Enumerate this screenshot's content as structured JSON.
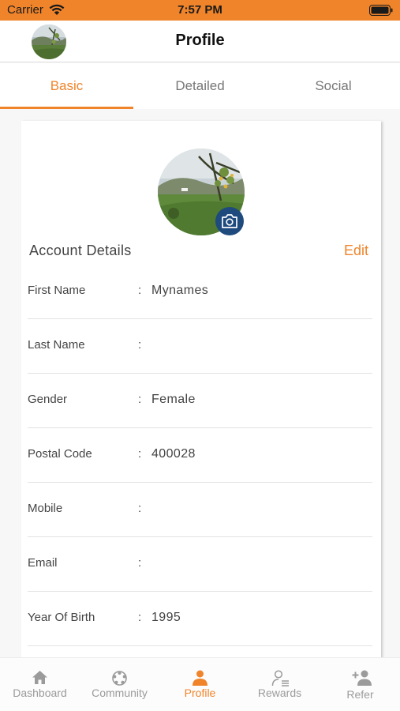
{
  "status_bar": {
    "carrier": "Carrier",
    "time": "7:57 PM"
  },
  "header": {
    "title": "Profile"
  },
  "tabs": [
    {
      "label": "Basic",
      "active": true
    },
    {
      "label": "Detailed",
      "active": false
    },
    {
      "label": "Social",
      "active": false
    }
  ],
  "account": {
    "section_title": "Account Details",
    "edit_label": "Edit",
    "separator": ":",
    "fields": [
      {
        "label": "First Name",
        "value": "Mynames"
      },
      {
        "label": "Last Name",
        "value": ""
      },
      {
        "label": "Gender",
        "value": "Female"
      },
      {
        "label": "Postal Code",
        "value": "400028"
      },
      {
        "label": "Mobile",
        "value": ""
      },
      {
        "label": "Email",
        "value": ""
      },
      {
        "label": "Year Of Birth",
        "value": "1995"
      }
    ]
  },
  "bottom_nav": [
    {
      "label": "Dashboard",
      "icon": "home-icon",
      "active": false
    },
    {
      "label": "Community",
      "icon": "community-icon",
      "active": false
    },
    {
      "label": "Profile",
      "icon": "person-icon",
      "active": true
    },
    {
      "label": "Rewards",
      "icon": "rewards-icon",
      "active": false
    },
    {
      "label": "Refer",
      "icon": "add-person-icon",
      "active": false
    }
  ],
  "colors": {
    "accent": "#f0842a",
    "camera_button": "#1e4a7e",
    "inactive": "#9b9b9b"
  }
}
